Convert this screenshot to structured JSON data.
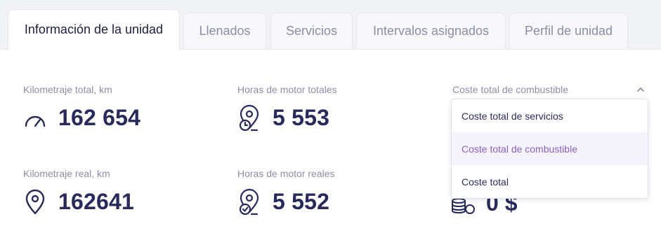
{
  "tabs": [
    {
      "label": "Información de la unidad",
      "active": true
    },
    {
      "label": "Llenados",
      "active": false
    },
    {
      "label": "Servicios",
      "active": false
    },
    {
      "label": "Intervalos asignados",
      "active": false
    },
    {
      "label": "Perfil de unidad",
      "active": false
    }
  ],
  "stats": {
    "total_mileage": {
      "label": "Kilometraje total, km",
      "value": "162 654",
      "icon": "speedometer-icon"
    },
    "total_engine_hours": {
      "label": "Horas de motor totales",
      "value": "5 553",
      "icon": "location-clock-icon"
    },
    "real_mileage": {
      "label": "Kilometraje real, km",
      "value": "162641",
      "icon": "location-pin-icon"
    },
    "real_engine_hours": {
      "label": "Horas de motor reales",
      "value": "5 552",
      "icon": "location-check-icon"
    }
  },
  "cost_selector": {
    "current_label": "Coste total de combustible",
    "options": [
      "Coste total de servicios",
      "Coste total de combustible",
      "Coste total"
    ],
    "selected_index": 1,
    "value_partial": "0 $",
    "icon": "coins-icon"
  },
  "colors": {
    "accent": "#8b5fc2",
    "value_text": "#282a5c",
    "label_text": "#8d8fa6"
  }
}
